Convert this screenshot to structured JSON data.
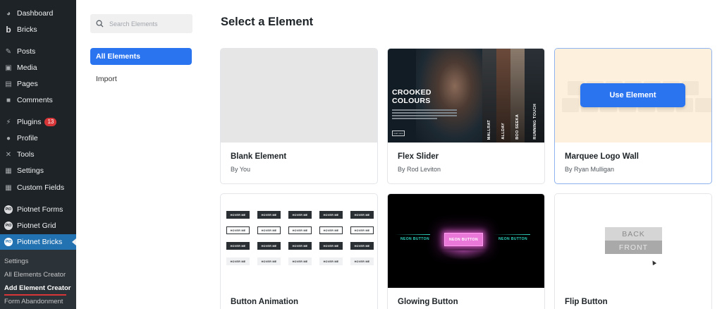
{
  "sidebar": {
    "items": [
      {
        "label": "Dashboard",
        "icon": "dashboard-icon",
        "glyph": "◕"
      },
      {
        "label": "Bricks",
        "icon": "bricks-icon",
        "glyph": "b"
      },
      {
        "label": "Posts",
        "icon": "pin-icon",
        "glyph": "✎"
      },
      {
        "label": "Media",
        "icon": "media-icon",
        "glyph": "▣"
      },
      {
        "label": "Pages",
        "icon": "pages-icon",
        "glyph": "▤"
      },
      {
        "label": "Comments",
        "icon": "comment-icon",
        "glyph": "■"
      },
      {
        "label": "Plugins",
        "icon": "plugin-icon",
        "glyph": "⚡",
        "badge": "13"
      },
      {
        "label": "Profile",
        "icon": "user-icon",
        "glyph": "●"
      },
      {
        "label": "Tools",
        "icon": "wrench-icon",
        "glyph": "✕"
      },
      {
        "label": "Settings",
        "icon": "settings-icon",
        "glyph": "▦"
      },
      {
        "label": "Custom Fields",
        "icon": "table-icon",
        "glyph": "▦"
      },
      {
        "label": "Piotnet Forms",
        "icon": "piotnet-logo-icon",
        "glyph": "PIO"
      },
      {
        "label": "Piotnet Grid",
        "icon": "piotnet-logo-icon",
        "glyph": "PIO"
      },
      {
        "label": "Piotnet Bricks",
        "icon": "piotnet-logo-icon",
        "glyph": "PIO",
        "active": true
      }
    ],
    "submenu": [
      {
        "label": "Settings"
      },
      {
        "label": "All Elements Creator"
      },
      {
        "label": "Add Element Creator",
        "current": true
      },
      {
        "label": "Form Abandonment"
      }
    ]
  },
  "filters": {
    "search_placeholder": "Search Elements",
    "all_label": "All Elements",
    "import_label": "Import"
  },
  "main": {
    "title": "Select a Element",
    "use_element_label": "Use Element",
    "cards": [
      {
        "title": "Blank Element",
        "author": "By You"
      },
      {
        "title": "Flex Slider",
        "author": "By Rod Leviton"
      },
      {
        "title": "Marquee Logo Wall",
        "author": "By Ryan Mulligan"
      },
      {
        "title": "Button Animation",
        "author": ""
      },
      {
        "title": "Glowing Button",
        "author": ""
      },
      {
        "title": "Flip Button",
        "author": ""
      }
    ]
  },
  "previews": {
    "flex_slider": {
      "heading": "CROOKED COLOURS",
      "button": "read more",
      "side_labels": [
        "MALLRAT",
        "ALLDAY",
        "BOO SEEKA",
        "RUNNING TOUCH"
      ]
    },
    "button_animation": {
      "chip_label": "HOVER ME"
    },
    "glowing_button": {
      "label": "NEON BUTTON"
    },
    "flip_button": {
      "back": "BACK",
      "front": "FRONT"
    }
  },
  "colors": {
    "accent": "#2b74f0",
    "sidebar_bg": "#1d2327",
    "sidebar_active": "#2271b1",
    "badge": "#d63638",
    "neon_cyan": "#2ed6c2",
    "neon_pink": "#e978d8"
  }
}
